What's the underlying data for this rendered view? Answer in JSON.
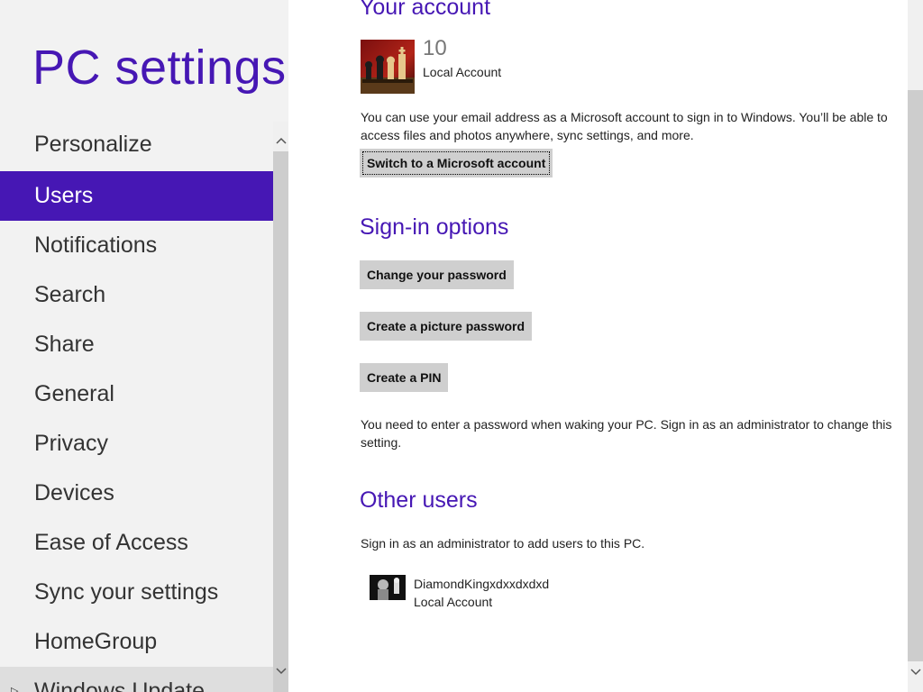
{
  "app": {
    "title": "PC settings"
  },
  "nav": {
    "items": [
      {
        "label": "Personalize"
      },
      {
        "label": "Users"
      },
      {
        "label": "Notifications"
      },
      {
        "label": "Search"
      },
      {
        "label": "Share"
      },
      {
        "label": "General"
      },
      {
        "label": "Privacy"
      },
      {
        "label": "Devices"
      },
      {
        "label": "Ease of Access"
      },
      {
        "label": "Sync your settings"
      },
      {
        "label": "HomeGroup"
      },
      {
        "label": "Windows Update"
      }
    ],
    "selected": "Users",
    "scroll_up_icon": "chevron-up-icon",
    "scroll_down_icon": "chevron-down-icon",
    "expand_icon": "triangle-right-icon"
  },
  "your_account": {
    "heading": "Your account",
    "user_name": "10",
    "account_type": "Local Account",
    "description": "You can use your email address as a Microsoft account to sign in to Windows. You’ll be able to access files and photos anywhere, sync settings, and more.",
    "switch_button": "Switch to a Microsoft account",
    "avatar_icon": "chess-pieces-avatar"
  },
  "sign_in_options": {
    "heading": "Sign-in options",
    "change_password_button": "Change your password",
    "picture_password_button": "Create a picture password",
    "pin_button": "Create a PIN",
    "note": "You need to enter a password when waking your PC. Sign in as an administrator to change this setting."
  },
  "other_users": {
    "heading": "Other users",
    "note": "Sign in as an administrator to add users to this PC.",
    "users": [
      {
        "name": "DiamondKingxdxxdxdxd",
        "type": "Local Account"
      }
    ]
  },
  "colors": {
    "accent": "#4617b4",
    "nav_background": "#f2f2f2",
    "button_background": "#cfcfcf",
    "content_background": "#ffffff"
  }
}
